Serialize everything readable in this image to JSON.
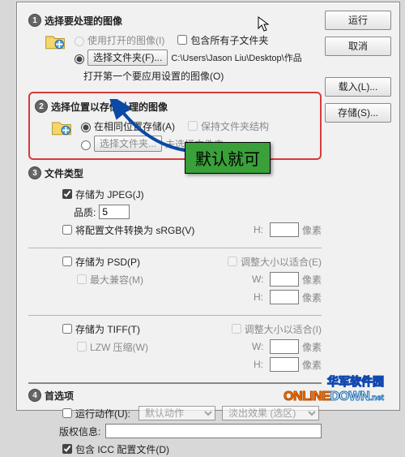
{
  "buttons": {
    "run": "运行",
    "cancel": "取消",
    "load": "载入(L)...",
    "save": "存储(S)..."
  },
  "section1": {
    "title": "选择要处理的图像",
    "opt_open": "使用打开的图像(I)",
    "include_sub": "包含所有子文件夹",
    "opt_folder": "选择文件夹(F)...",
    "folder_path": "C:\\Users\\Jason Liu\\Desktop\\作品",
    "first_apply": "打开第一个要应用设置的图像(O)"
  },
  "section2": {
    "title": "选择位置以存储处理的图像",
    "opt_same": "在相同位置存储(A)",
    "keep_struct": "保持文件夹结构",
    "opt_choose": "选择文件夹...",
    "not_chosen": "未选择文件夹"
  },
  "section3": {
    "title": "文件类型",
    "jpeg": "存储为 JPEG(J)",
    "quality_label": "品质:",
    "quality_value": "5",
    "convert_srgb": "将配置文件转换为 sRGB(V)",
    "psd": "存储为 PSD(P)",
    "max_compat": "最大兼容(M)",
    "tiff": "存储为 TIFF(T)",
    "lzw": "LZW 压缩(W)",
    "resize": "调整大小以适合(E)",
    "resize2": "调整大小以适合(I)",
    "w": "W:",
    "h": "H:",
    "unit": "像素"
  },
  "section4": {
    "title": "首选项",
    "run_action": "运行动作(U):",
    "action_set": "默认动作",
    "action_name": "淡出效果 (选区)",
    "copyright_label": "版权信息:",
    "copyright_value": "",
    "icc": "包含 ICC 配置文件(D)"
  },
  "tooltip": "默认就可",
  "watermark": {
    "cn": "华军软件园",
    "en1": "ONLINE",
    "en2": "DOWN",
    "net": ".net"
  }
}
